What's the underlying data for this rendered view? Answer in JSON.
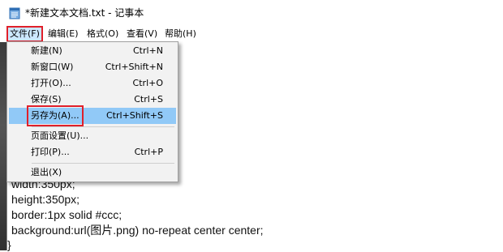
{
  "window": {
    "title": "*新建文本文档.txt - 记事本",
    "icon": "notepad-icon"
  },
  "menubar": {
    "items": [
      {
        "label": "文件(F)",
        "active": true
      },
      {
        "label": "编辑(E)"
      },
      {
        "label": "格式(O)"
      },
      {
        "label": "查看(V)"
      },
      {
        "label": "帮助(H)"
      }
    ]
  },
  "file_menu": {
    "items": [
      {
        "label": "新建(N)",
        "shortcut": "Ctrl+N"
      },
      {
        "label": "新窗口(W)",
        "shortcut": "Ctrl+Shift+N"
      },
      {
        "label": "打开(O)...",
        "shortcut": "Ctrl+O"
      },
      {
        "label": "保存(S)",
        "shortcut": "Ctrl+S"
      },
      {
        "label": "另存为(A)...",
        "shortcut": "Ctrl+Shift+S",
        "highlighted": true
      },
      {
        "label": "页面设置(U)...",
        "shortcut": ""
      },
      {
        "label": "打印(P)...",
        "shortcut": "Ctrl+P"
      },
      {
        "label": "退出(X)",
        "shortcut": ""
      }
    ]
  },
  "editor": {
    "lines": [
      "width:350px;",
      "height:350px;",
      "border:1px solid #ccc;",
      "background:url(图片.png) no-repeat center center;",
      "}"
    ]
  },
  "colors": {
    "highlight": "#91c9f7",
    "annotation_box": "#e0202a",
    "menu_bg": "#f2f2f2"
  }
}
